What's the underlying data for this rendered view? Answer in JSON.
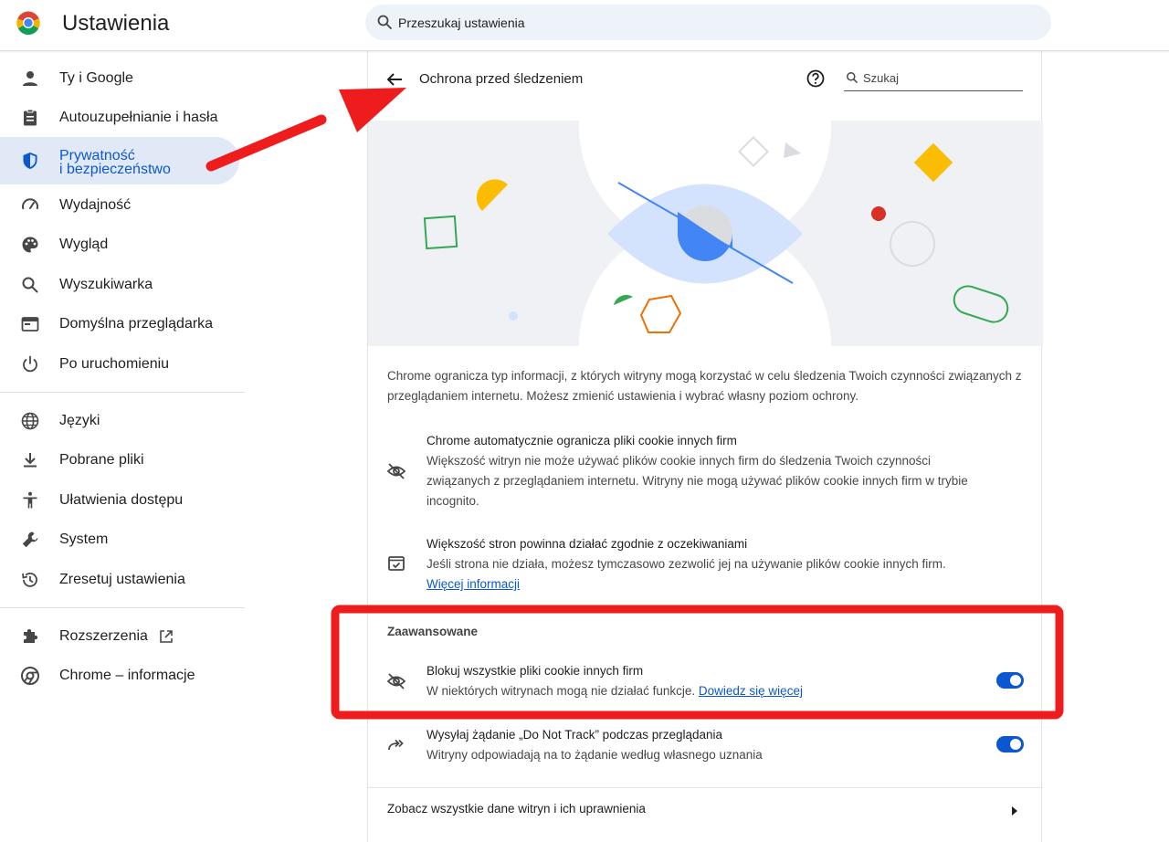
{
  "app": {
    "title": "Ustawienia"
  },
  "search": {
    "placeholder": "Przeszukaj ustawienia"
  },
  "sidebar": {
    "items": [
      {
        "label": "Ty i Google",
        "icon": "person-icon"
      },
      {
        "label": "Autouzupełnianie i hasła",
        "icon": "clipboard-icon"
      },
      {
        "label_line1": "Prywatność",
        "label_line2": "i bezpieczeństwo",
        "icon": "shield-icon",
        "active": true
      },
      {
        "label": "Wydajność",
        "icon": "gauge-icon"
      },
      {
        "label": "Wygląd",
        "icon": "palette-icon"
      },
      {
        "label": "Wyszukiwarka",
        "icon": "search-icon"
      },
      {
        "label": "Domyślna przeglądarka",
        "icon": "browser-window-icon"
      },
      {
        "label": "Po uruchomieniu",
        "icon": "power-icon"
      },
      {
        "label": "Języki",
        "icon": "globe-icon"
      },
      {
        "label": "Pobrane pliki",
        "icon": "download-icon"
      },
      {
        "label": "Ułatwienia dostępu",
        "icon": "accessibility-icon"
      },
      {
        "label": "System",
        "icon": "wrench-icon"
      },
      {
        "label": "Zresetuj ustawienia",
        "icon": "reset-history-icon"
      },
      {
        "label": "Rozszerzenia",
        "icon": "puzzle-icon"
      },
      {
        "label": "Chrome – informacje",
        "icon": "chrome-icon"
      }
    ]
  },
  "panel": {
    "title": "Ochrona przed śledzeniem",
    "search_placeholder": "Szukaj",
    "intro": "Chrome ogranicza typ informacji, z których witryny mogą korzystać w celu śledzenia Twoich czynności związanych z przeglądaniem internetu. Możesz zmienić ustawienia i wybrać własny poziom ochrony.",
    "rows": [
      {
        "title": "Chrome automatycznie ogranicza pliki cookie innych firm",
        "desc": "Większość witryn nie może używać plików cookie innych firm do śledzenia Twoich czynności związanych z przeglądaniem internetu. Witryny nie mogą używać plików cookie innych firm w trybie incognito.",
        "icon": "eye-off-icon"
      },
      {
        "title": "Większość stron powinna działać zgodnie z oczekiwaniami",
        "desc": "Jeśli strona nie działa, możesz tymczasowo zezwolić jej na używanie plików cookie innych firm.",
        "link": "Więcej informacji",
        "icon": "browser-check-icon"
      }
    ],
    "advanced": {
      "heading": "Zaawansowane",
      "block_cookies": {
        "title": "Blokuj wszystkie pliki cookie innych firm",
        "desc": "W niektórych witrynach mogą nie działać funkcje.",
        "link": "Dowiedz się więcej",
        "enabled": true,
        "icon": "eye-off-icon"
      },
      "do_not_track": {
        "title": "Wysyłaj żądanie „Do Not Track” podczas przeglądania",
        "desc": "Witryny odpowiadają na to żądanie według własnego uznania",
        "enabled": true,
        "icon": "forward-arrows-icon"
      }
    },
    "site_data": {
      "label": "Zobacz wszystkie dane witryn i ich uprawnienia"
    }
  },
  "colors": {
    "accent": "#0b57d0",
    "active_nav_bg": "#e1e9f7",
    "annotation_red": "#ee1c1c"
  }
}
